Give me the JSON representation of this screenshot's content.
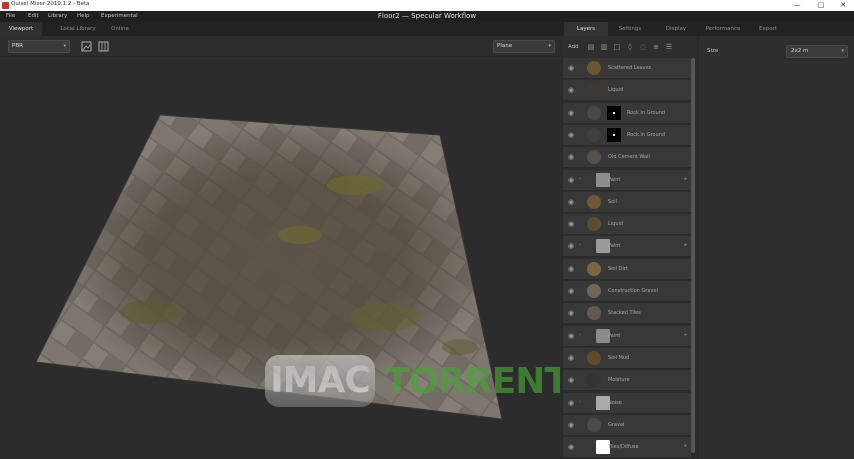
{
  "window": {
    "app_title": "Quixel Mixer 2019.1.2 - Beta",
    "document_title": "Floor2 — Specular Workflow",
    "controls": {
      "minimize": "—",
      "maximize": "□",
      "close": "✕"
    }
  },
  "menu": [
    "File",
    "Edit",
    "Library",
    "Help",
    "Experimental"
  ],
  "left_tabs": [
    {
      "label": "Viewport",
      "active": true
    },
    {
      "label": "Local Library",
      "active": false
    },
    {
      "label": "Online",
      "active": false
    }
  ],
  "toolbar": {
    "render_mode": "PBR",
    "plane_select": "Plane",
    "icons": [
      "image-icon",
      "grid-icon"
    ]
  },
  "right_tabs": [
    {
      "label": "Layers",
      "active": true
    },
    {
      "label": "Settings",
      "active": false
    },
    {
      "label": "Display",
      "active": false
    },
    {
      "label": "Performance",
      "active": false
    },
    {
      "label": "Export",
      "active": false
    }
  ],
  "layers_toolbar": {
    "add_label": "Add",
    "icons": [
      "layer-add-icon",
      "folder-add-icon",
      "square-icon",
      "drop-icon",
      "fill-icon",
      "list-icon",
      "stack-icon"
    ]
  },
  "layers": [
    {
      "name": "Scattered Leaves",
      "thumb_color": "#6b5533",
      "kind": "round",
      "expand": "",
      "has_arrow": false
    },
    {
      "name": "Liquid",
      "thumb_color": "#3d3a35",
      "kind": "round",
      "expand": "",
      "has_arrow": false
    },
    {
      "name": "Rock in Ground",
      "thumb_color": "#484848",
      "kind": "round-mask",
      "expand": "",
      "has_arrow": false
    },
    {
      "name": "Rock in Ground",
      "thumb_color": "#3f3f3f",
      "kind": "round-mask",
      "expand": "",
      "has_arrow": false
    },
    {
      "name": "Old Cement Wall",
      "thumb_color": "#555049",
      "kind": "round",
      "expand": "",
      "has_arrow": false
    },
    {
      "name": "Paint",
      "thumb_color": "#8d8d8d",
      "kind": "square",
      "expand": "›",
      "has_arrow": true
    },
    {
      "name": "Soil",
      "thumb_color": "#6e5733",
      "kind": "round",
      "expand": "",
      "has_arrow": false
    },
    {
      "name": "Liquid",
      "thumb_color": "#5e4b32",
      "kind": "round",
      "expand": "",
      "has_arrow": false
    },
    {
      "name": "Paint",
      "thumb_color": "#9a9a9a",
      "kind": "square",
      "expand": "›",
      "has_arrow": true
    },
    {
      "name": "Soil Dirt",
      "thumb_color": "#7b6644",
      "kind": "round",
      "expand": "",
      "has_arrow": false
    },
    {
      "name": "Construction Gravel",
      "thumb_color": "#6e6659",
      "kind": "round",
      "expand": "",
      "has_arrow": false
    },
    {
      "name": "Stacked Tiles",
      "thumb_color": "#605a52",
      "kind": "round",
      "expand": "",
      "has_arrow": false
    },
    {
      "name": "Paint",
      "thumb_color": "#8a8a8a",
      "kind": "square",
      "expand": "›",
      "has_arrow": true
    },
    {
      "name": "Soil Mud",
      "thumb_color": "#5f4a2c",
      "kind": "round",
      "expand": "",
      "has_arrow": false
    },
    {
      "name": "Moisture",
      "thumb_color": "#333333",
      "kind": "round",
      "expand": "",
      "has_arrow": false
    },
    {
      "name": "Noise",
      "thumb_color": "#aaaaaa",
      "kind": "square",
      "expand": "›",
      "has_arrow": false
    },
    {
      "name": "Gravel",
      "thumb_color": "#4b4b4b",
      "kind": "round",
      "expand": "",
      "has_arrow": false
    },
    {
      "name": "Tiles/Diffuse",
      "thumb_color": "#ffffff",
      "kind": "square",
      "expand": "",
      "has_arrow": true
    }
  ],
  "properties": {
    "size_label": "Size",
    "size_value": "2x2 m"
  },
  "watermark": {
    "left": "IMAC",
    "right": "TORRENTS"
  },
  "colors": {
    "accent_red": "#c0392b",
    "watermark_green": "#4aa336",
    "panel": "#2e2e2e"
  }
}
